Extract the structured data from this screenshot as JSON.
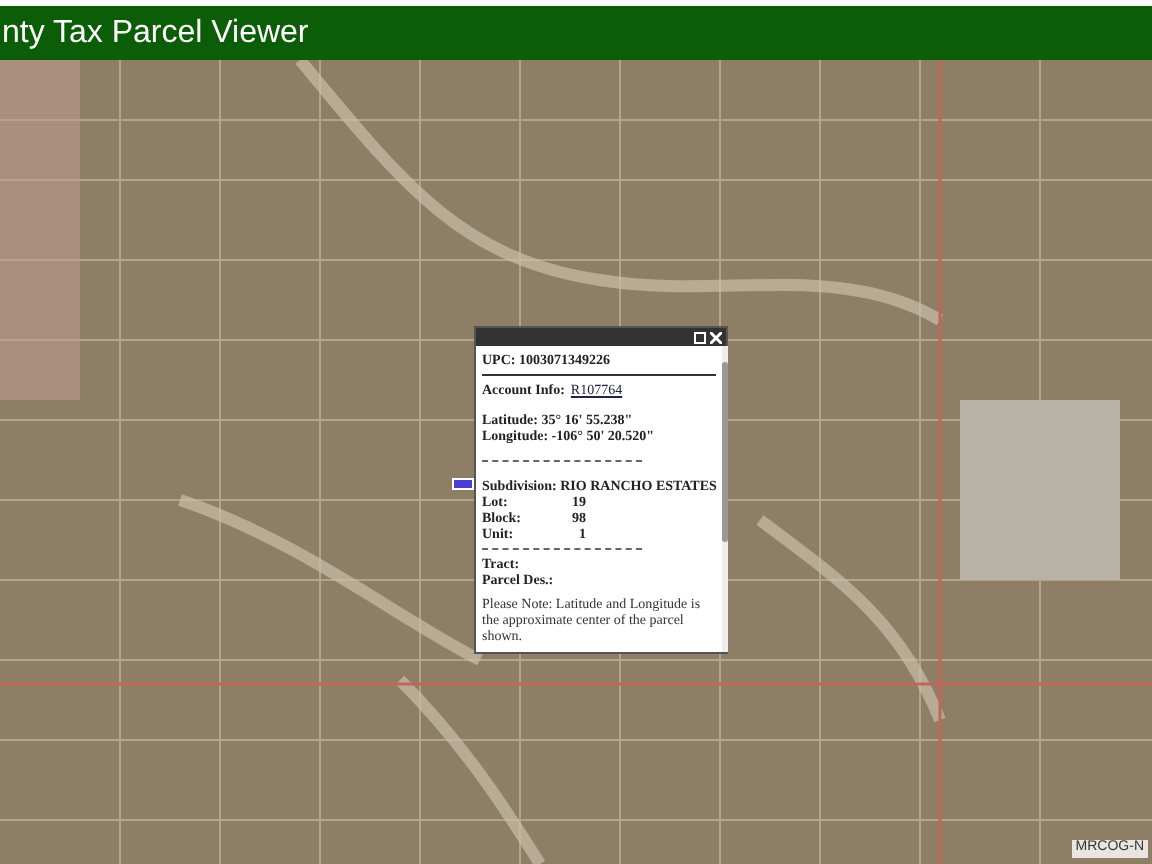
{
  "header": {
    "title": "nty Tax Parcel Viewer"
  },
  "map": {
    "credit": "MRCOG-N"
  },
  "popup": {
    "upc": "UPC: 1003071349226",
    "account_label": "Account Info:",
    "account_link": "R107764",
    "latitude": "Latitude: 35° 16' 55.238\"",
    "longitude": "Longitude: -106° 50' 20.520\"",
    "subdivision": "Subdivision: RIO RANCHO ESTATES",
    "fields": [
      {
        "label": "Lot:",
        "value": "19"
      },
      {
        "label": "Block:",
        "value": "98"
      },
      {
        "label": "Unit:",
        "value": "1"
      }
    ],
    "tract": "Tract:",
    "parcel_des": "Parcel Des.:",
    "note": "Please Note: Latitude and Longitude is the approximate center of the parcel shown."
  }
}
